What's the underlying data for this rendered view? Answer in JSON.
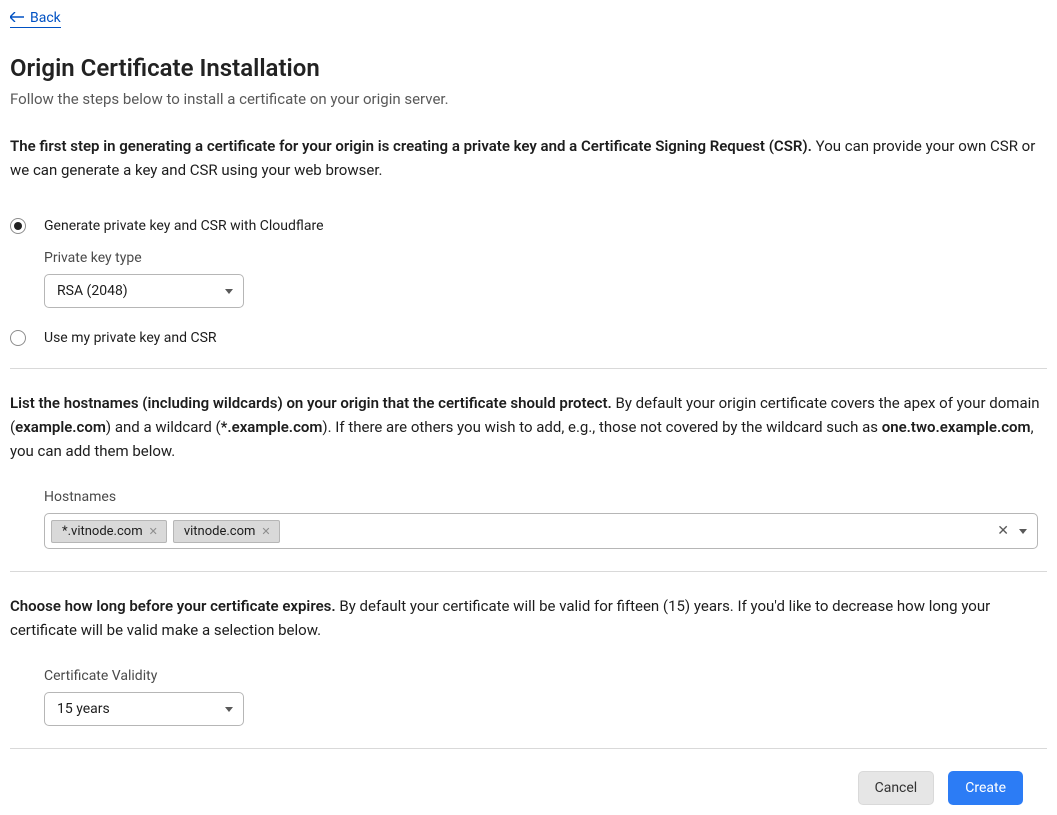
{
  "back": {
    "label": "Back"
  },
  "page": {
    "title": "Origin Certificate Installation",
    "subtitle": "Follow the steps below to install a certificate on your origin server."
  },
  "intro": {
    "bold": "The first step in generating a certificate for your origin is creating a private key and a Certificate Signing Request (CSR).",
    "rest": " You can provide your own CSR or we can generate a key and CSR using your web browser."
  },
  "csr": {
    "option_generate": "Generate private key and CSR with Cloudflare",
    "option_own": "Use my private key and CSR",
    "key_type_label": "Private key type",
    "key_type_value": "RSA (2048)"
  },
  "hostnames_section": {
    "bold": "List the hostnames (including wildcards) on your origin that the certificate should protect.",
    "t1": " By default your origin certificate covers the apex of your domain (",
    "b1": "example.com",
    "t2": ") and a wildcard (",
    "b2": "*.example.com",
    "t3": "). If there are others you wish to add, e.g., those not covered by the wildcard such as ",
    "b3": "one.two.example.com",
    "t4": ", you can add them below.",
    "label": "Hostnames",
    "tags": [
      "*.vitnode.com",
      "vitnode.com"
    ]
  },
  "validity_section": {
    "bold": "Choose how long before your certificate expires.",
    "rest": " By default your certificate will be valid for fifteen (15) years. If you'd like to decrease how long your certificate will be valid make a selection below.",
    "label": "Certificate Validity",
    "value": "15 years"
  },
  "buttons": {
    "cancel": "Cancel",
    "create": "Create"
  }
}
